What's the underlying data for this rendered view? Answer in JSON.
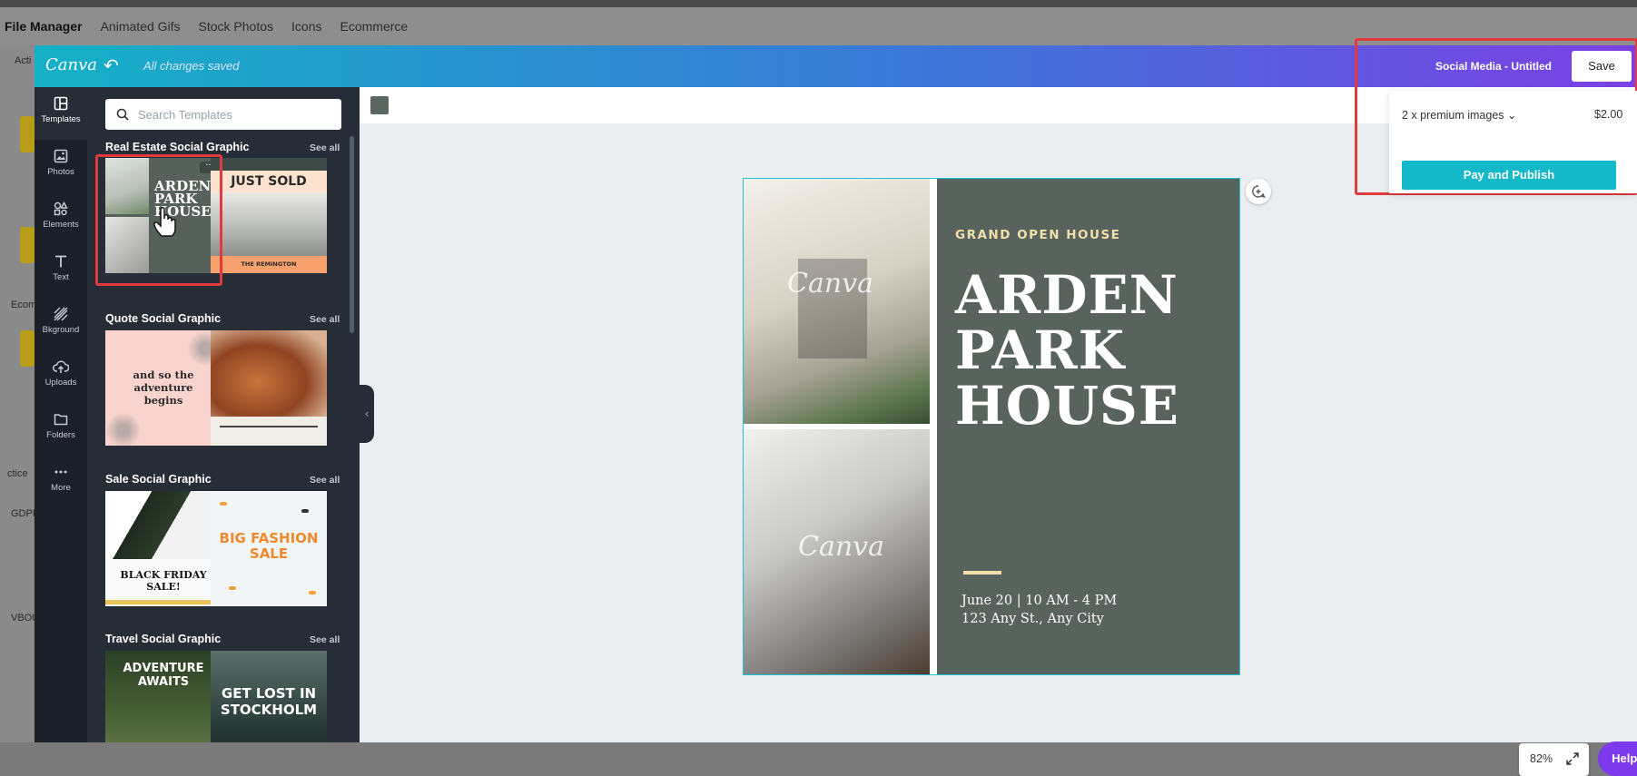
{
  "background_app": {
    "nav_items": [
      "File Manager",
      "Animated Gifs",
      "Stock Photos",
      "Icons",
      "Ecommerce"
    ],
    "side_labels": [
      "Acti",
      "Ecom",
      "ctice",
      "GDPR",
      "VBOU"
    ]
  },
  "header": {
    "logo": "Canva",
    "status": "All changes saved",
    "document_title": "Social Media - Untitled",
    "save_label": "Save"
  },
  "rail": {
    "items": [
      {
        "label": "Templates",
        "icon": "templates-icon"
      },
      {
        "label": "Photos",
        "icon": "photos-icon"
      },
      {
        "label": "Elements",
        "icon": "elements-icon"
      },
      {
        "label": "Text",
        "icon": "text-icon"
      },
      {
        "label": "Bkground",
        "icon": "background-icon"
      },
      {
        "label": "Uploads",
        "icon": "uploads-icon"
      },
      {
        "label": "Folders",
        "icon": "folders-icon"
      },
      {
        "label": "More",
        "icon": "more-icon"
      }
    ]
  },
  "panel": {
    "search_placeholder": "Search Templates",
    "see_all": "See all",
    "sections": [
      {
        "title": "Real Estate Social Graphic"
      },
      {
        "title": "Quote Social Graphic"
      },
      {
        "title": "Sale Social Graphic"
      },
      {
        "title": "Travel Social Graphic"
      }
    ],
    "thumbs": {
      "t1_line1": "ARDEN",
      "t1_line2": "PARK",
      "t1_line3": "HOUSE",
      "t2_title": "JUST SOLD",
      "t2_sub": "THE REMINGTON",
      "t3_text": "and so the adventure begins",
      "t5_text": "BLACK FRIDAY SALE!",
      "t6_line1": "BIG FASHION",
      "t6_line2": "SALE",
      "t7_text": "ADVENTURE AWAITS",
      "t8_line1": "GET LOST IN",
      "t8_line2": "STOCKHOLM"
    }
  },
  "design": {
    "watermark": "Canva",
    "subtitle": "GRAND OPEN HOUSE",
    "title_line1": "ARDEN",
    "title_line2": "PARK",
    "title_line3": "HOUSE",
    "date": "June 20 | 10 AM - 4 PM",
    "address": "123 Any St., Any City",
    "bg_color": "#59635e",
    "accent_color": "#f2dfa9"
  },
  "publish": {
    "premium": "2 x premium images",
    "price": "$2.00",
    "pay_label": "Pay and Publish"
  },
  "footer": {
    "zoom": "82%",
    "help": "Help ?"
  }
}
